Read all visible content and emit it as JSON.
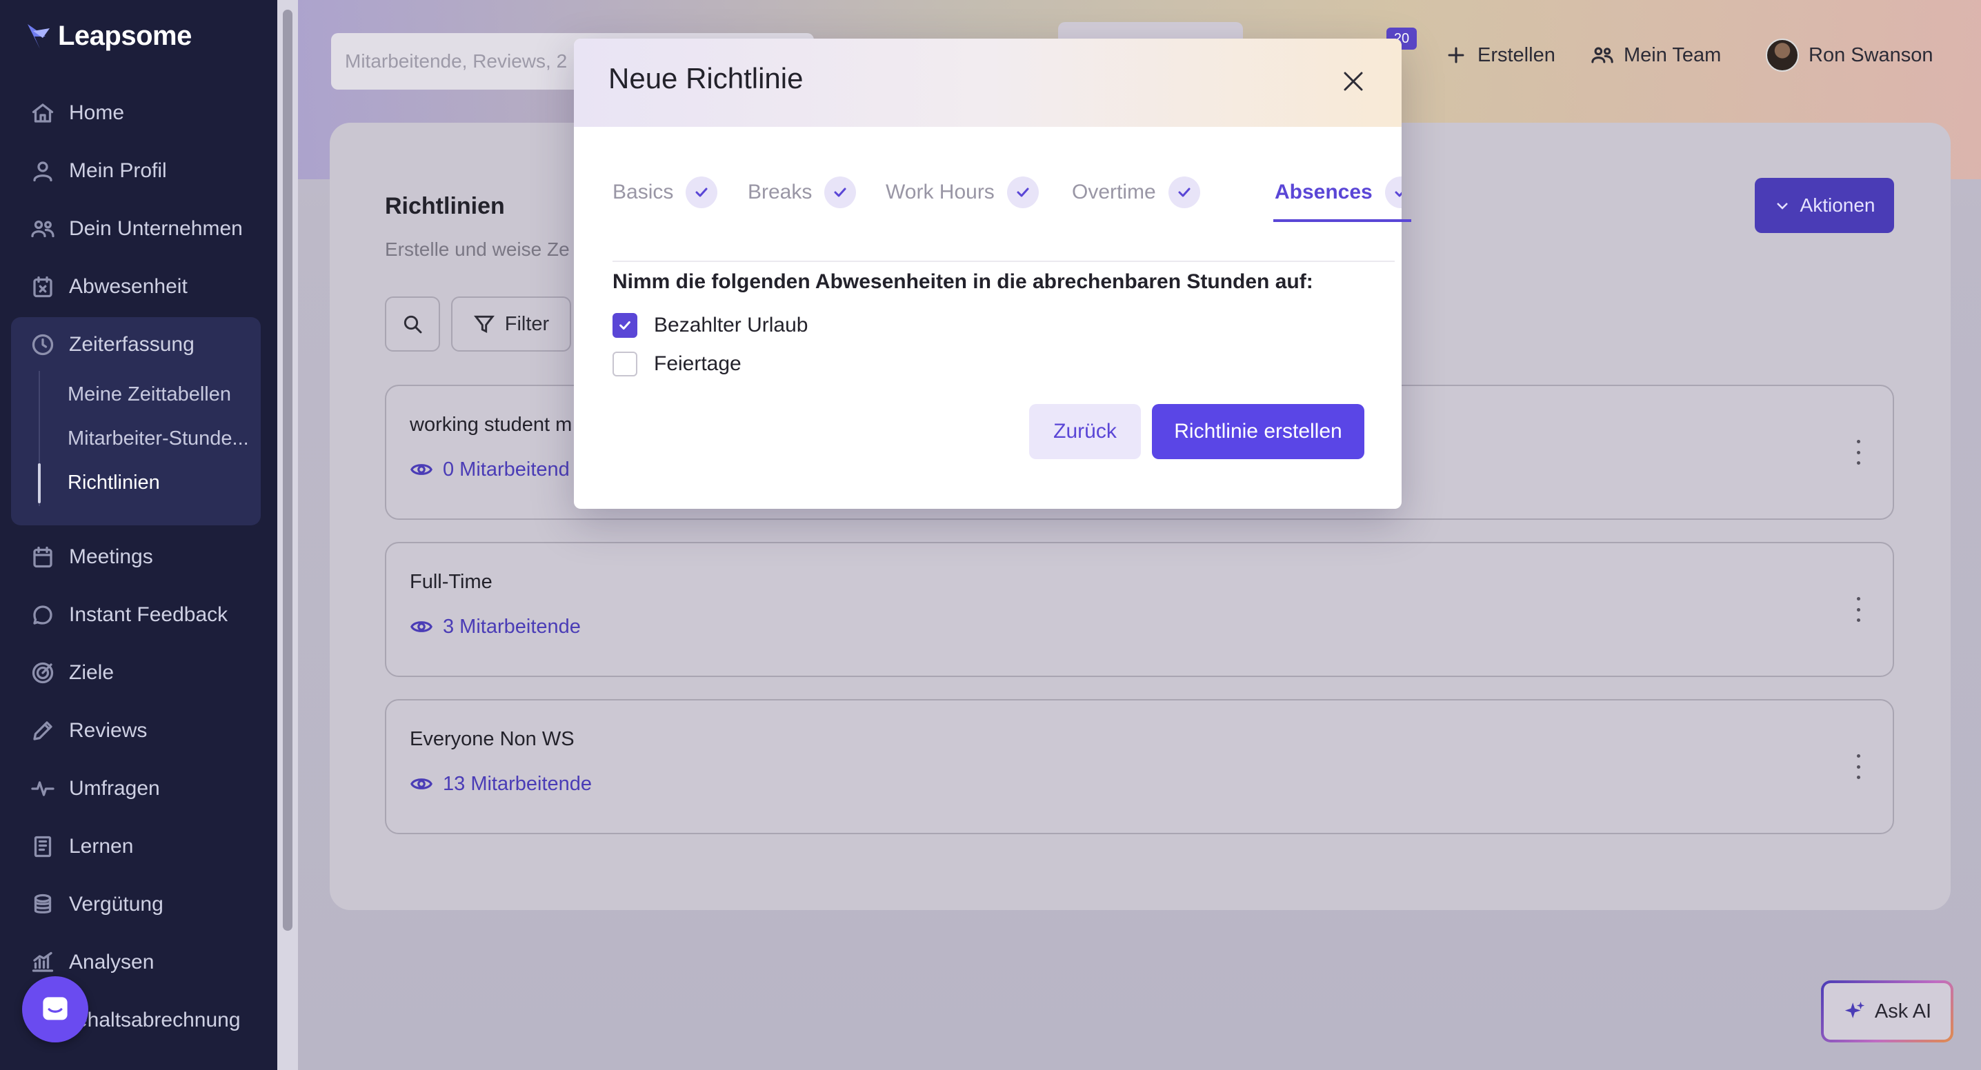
{
  "app": {
    "name": "Leapsome"
  },
  "sidebar": {
    "items": [
      {
        "label": "Home",
        "icon": "home-icon"
      },
      {
        "label": "Mein Profil",
        "icon": "user-icon"
      },
      {
        "label": "Dein Unternehmen",
        "icon": "people-icon"
      },
      {
        "label": "Abwesenheit",
        "icon": "calendar-x-icon"
      },
      {
        "label": "Zeiterfassung",
        "icon": "clock-icon"
      },
      {
        "label": "Meetings",
        "icon": "calendar-icon"
      },
      {
        "label": "Instant Feedback",
        "icon": "chat-icon"
      },
      {
        "label": "Ziele",
        "icon": "target-icon"
      },
      {
        "label": "Reviews",
        "icon": "pencil-icon"
      },
      {
        "label": "Umfragen",
        "icon": "pulse-icon"
      },
      {
        "label": "Lernen",
        "icon": "book-icon"
      },
      {
        "label": "Vergütung",
        "icon": "coins-icon"
      },
      {
        "label": "Analysen",
        "icon": "chart-icon"
      },
      {
        "label": "ehaltsabrechnung",
        "icon": "none"
      }
    ],
    "sub_items": [
      {
        "label": "Meine Zeittabellen"
      },
      {
        "label": "Mitarbeiter-Stunde..."
      },
      {
        "label": "Richtlinien",
        "active": true
      }
    ]
  },
  "header": {
    "search_placeholder": "Mitarbeitende, Reviews, 2",
    "notification_count": "20",
    "create_label": "Erstellen",
    "team_label": "Mein Team",
    "user_name": "Ron Swanson"
  },
  "page": {
    "title": "Richtlinien",
    "subtitle": "Erstelle und weise Ze",
    "actions_label": "Aktionen",
    "filter_label": "Filter",
    "policies": [
      {
        "name": "working student m",
        "members": "0 Mitarbeitend"
      },
      {
        "name": "Full-Time",
        "members": "3 Mitarbeitende"
      },
      {
        "name": "Everyone Non WS",
        "members": "13 Mitarbeitende"
      }
    ]
  },
  "modal": {
    "title": "Neue Richtlinie",
    "tabs": [
      {
        "label": "Basics",
        "done": true
      },
      {
        "label": "Breaks",
        "done": true
      },
      {
        "label": "Work Hours",
        "done": true
      },
      {
        "label": "Overtime",
        "done": true
      },
      {
        "label": "Absences",
        "done": true,
        "active": true
      }
    ],
    "question": "Nimm die folgenden Abwesenheiten in die abrechenbaren Stunden auf:",
    "options": [
      {
        "label": "Bezahlter Urlaub",
        "checked": true
      },
      {
        "label": "Feiertage",
        "checked": false
      }
    ],
    "back_label": "Zurück",
    "create_label": "Richtlinie erstellen"
  },
  "ask_ai": {
    "label": "Ask AI"
  },
  "colors": {
    "accent": "#5a46e6",
    "sidebar_bg": "#1c1e3a"
  }
}
